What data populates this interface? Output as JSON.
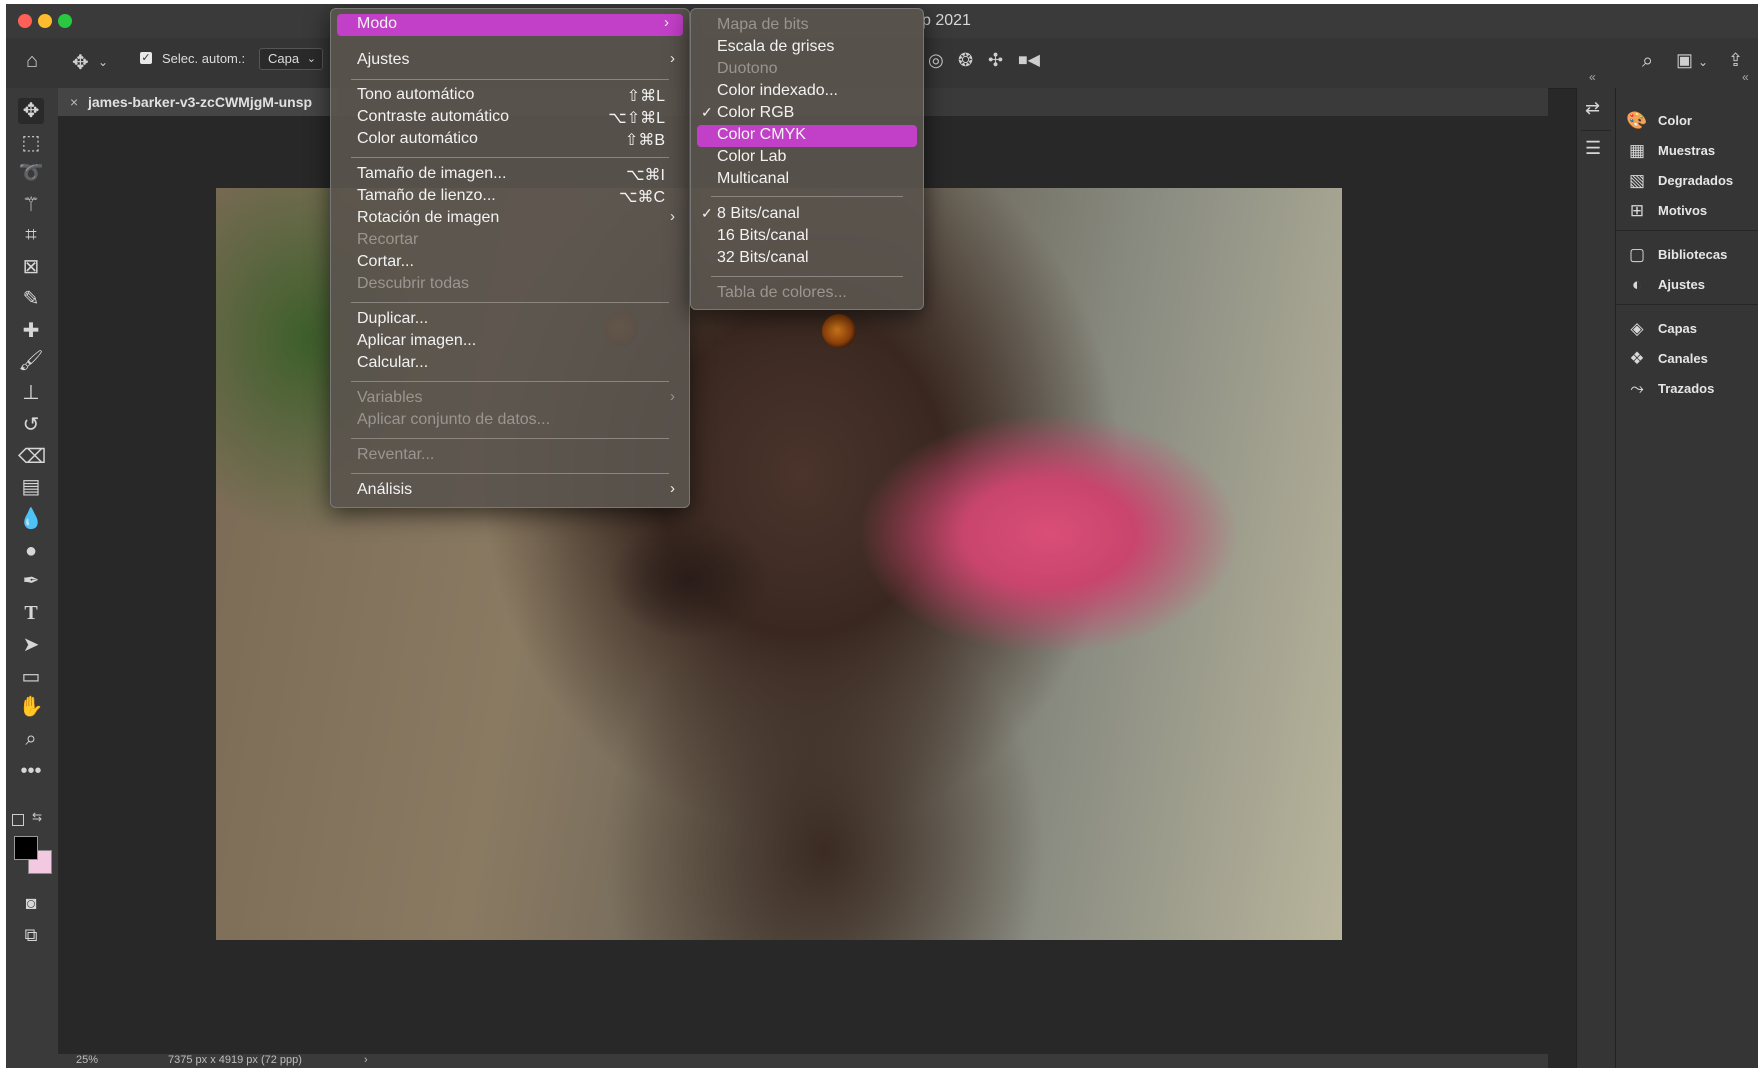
{
  "window": {
    "title": "p 2021"
  },
  "options_bar": {
    "auto_select_label": "Selec. autom.:",
    "auto_select_value": "Capa"
  },
  "document": {
    "tab_title": "james-barker-v3-zcCWMjgM-unsp"
  },
  "status_bar": {
    "zoom": "25%",
    "doc_info": "7375 px x 4919 px (72 ppp)"
  },
  "image_menu": {
    "items": [
      {
        "label": "Modo",
        "shortcut": "",
        "submenu": true,
        "highlighted": true
      },
      {
        "label": "Ajustes",
        "shortcut": "",
        "submenu": true
      },
      {
        "label": "Tono automático",
        "shortcut": "⇧⌘L"
      },
      {
        "label": "Contraste automático",
        "shortcut": "⌥⇧⌘L"
      },
      {
        "label": "Color automático",
        "shortcut": "⇧⌘B"
      },
      {
        "label": "Tamaño de imagen...",
        "shortcut": "⌥⌘I"
      },
      {
        "label": "Tamaño de lienzo...",
        "shortcut": "⌥⌘C"
      },
      {
        "label": "Rotación de imagen",
        "shortcut": "",
        "submenu": true
      },
      {
        "label": "Recortar",
        "shortcut": "",
        "disabled": true
      },
      {
        "label": "Cortar...",
        "shortcut": ""
      },
      {
        "label": "Descubrir todas",
        "shortcut": "",
        "disabled": true
      },
      {
        "label": "Duplicar...",
        "shortcut": ""
      },
      {
        "label": "Aplicar imagen...",
        "shortcut": ""
      },
      {
        "label": "Calcular...",
        "shortcut": ""
      },
      {
        "label": "Variables",
        "shortcut": "",
        "submenu": true,
        "disabled": true
      },
      {
        "label": "Aplicar conjunto de datos...",
        "shortcut": "",
        "disabled": true
      },
      {
        "label": "Reventar...",
        "shortcut": "",
        "disabled": true
      },
      {
        "label": "Análisis",
        "shortcut": "",
        "submenu": true
      }
    ]
  },
  "mode_submenu": {
    "items": [
      {
        "label": "Mapa de bits",
        "disabled": true
      },
      {
        "label": "Escala de grises"
      },
      {
        "label": "Duotono",
        "disabled": true
      },
      {
        "label": "Color indexado..."
      },
      {
        "label": "Color RGB",
        "checked": true
      },
      {
        "label": "Color CMYK",
        "highlighted": true
      },
      {
        "label": "Color Lab"
      },
      {
        "label": "Multicanal"
      },
      {
        "label": "8 Bits/canal",
        "checked": true
      },
      {
        "label": "16 Bits/canal"
      },
      {
        "label": "32 Bits/canal"
      },
      {
        "label": "Tabla de colores...",
        "disabled": true
      }
    ]
  },
  "panels": {
    "items": [
      {
        "label": "Color",
        "icon": "palette-icon"
      },
      {
        "label": "Muestras",
        "icon": "swatches-grid-icon"
      },
      {
        "label": "Degradados",
        "icon": "gradient-icon"
      },
      {
        "label": "Motivos",
        "icon": "patterns-icon"
      },
      {
        "label": "Bibliotecas",
        "icon": "libraries-icon"
      },
      {
        "label": "Ajustes",
        "icon": "adjustments-icon"
      },
      {
        "label": "Capas",
        "icon": "layers-icon"
      },
      {
        "label": "Canales",
        "icon": "channels-icon"
      },
      {
        "label": "Trazados",
        "icon": "paths-icon"
      }
    ]
  },
  "colors": {
    "menu_highlight": "#c23fc7",
    "foreground_swatch": "#000000",
    "background_swatch": "#f2c9e0"
  }
}
